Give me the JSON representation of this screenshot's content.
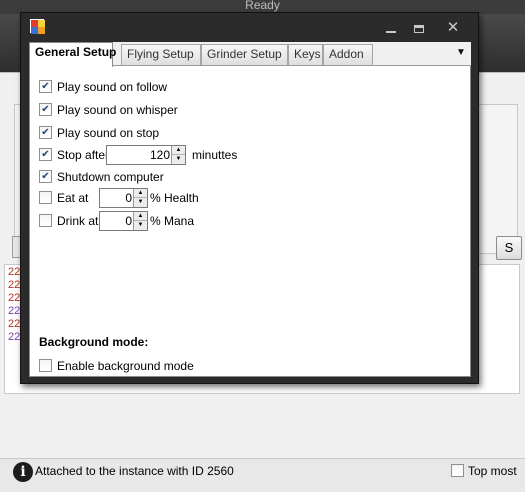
{
  "app": {
    "title": "Ready"
  },
  "background": {
    "right_button_label": "S",
    "log_lines": [
      {
        "text": "22",
        "color": "#b5321f"
      },
      {
        "text": "22",
        "color": "#b5321f"
      },
      {
        "text": "22",
        "color": "#b5321f"
      },
      {
        "text": "22",
        "color": "#7a3fb0"
      },
      {
        "text": "22",
        "color": "#b5321f"
      },
      {
        "text": "22",
        "color": "#7a3fb0"
      }
    ]
  },
  "dialog": {
    "tabs": [
      "General Setup",
      "Flying Setup",
      "Grinder Setup",
      "Keys",
      "Addon"
    ],
    "active_tab": "General Setup",
    "buttons": {
      "minimize": "minimize-icon",
      "maximize": "maximize-icon",
      "close": "close-icon"
    },
    "general": {
      "play_sound_follow": {
        "label": "Play sound on follow",
        "checked": true
      },
      "play_sound_whisper": {
        "label": "Play sound on whisper",
        "checked": true
      },
      "play_sound_stop": {
        "label": "Play sound on stop",
        "checked": true
      },
      "stop_after": {
        "label": "Stop after",
        "checked": true,
        "value": "120",
        "unit": "minuttes"
      },
      "shutdown": {
        "label": "Shutdown computer",
        "checked": true
      },
      "eat_at": {
        "label": "Eat at",
        "checked": false,
        "value": "0",
        "unit": "% Health"
      },
      "drink_at": {
        "label": "Drink at",
        "checked": false,
        "value": "0",
        "unit": "% Mana"
      },
      "background_mode_title": "Background mode:",
      "enable_background": {
        "label": "Enable background mode",
        "checked": false
      }
    }
  },
  "status": {
    "icon": "info-icon",
    "info_glyph": "i",
    "text": "Attached to the instance with ID 2560",
    "topmost": {
      "label": "Top most",
      "checked": false
    }
  }
}
